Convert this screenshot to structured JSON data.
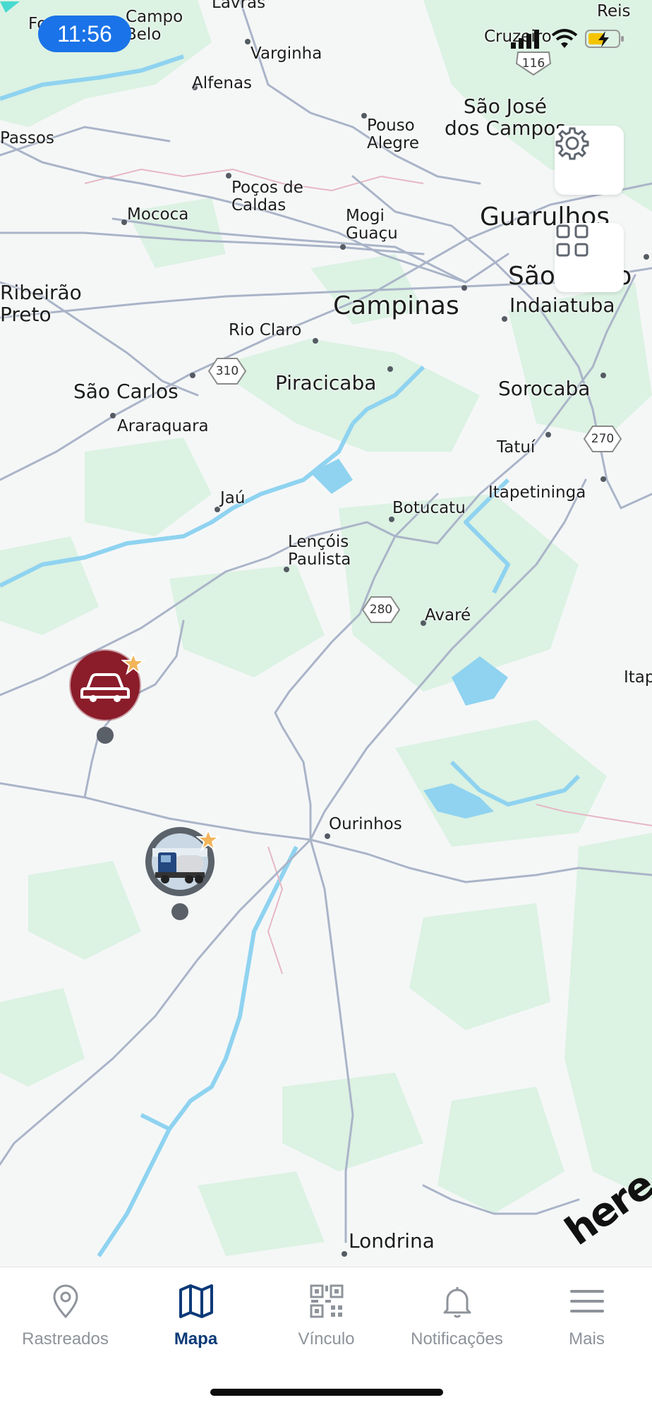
{
  "status_bar": {
    "time": "11:56"
  },
  "map": {
    "cities": [
      {
        "id": "lavras",
        "label": "Lavras"
      },
      {
        "id": "reis",
        "label": "Reis"
      },
      {
        "id": "campo-belo",
        "label": "Campo\nBelo"
      },
      {
        "id": "fo",
        "label": "Fo"
      },
      {
        "id": "cruzeiro",
        "label": "Cruzeiro"
      },
      {
        "id": "varginha",
        "label": "Varginha"
      },
      {
        "id": "alfenas",
        "label": "Alfenas"
      },
      {
        "id": "passos",
        "label": "Passos"
      },
      {
        "id": "pouso-alegre",
        "label": "Pouso\nAlegre"
      },
      {
        "id": "sao-jose",
        "label": "São José\ndos Campos"
      },
      {
        "id": "pocos",
        "label": "Poços de\nCaldas"
      },
      {
        "id": "mococa",
        "label": "Mococa"
      },
      {
        "id": "mogi",
        "label": "Mogi\nGuaçu"
      },
      {
        "id": "guarulhos",
        "label": "Guarulhos"
      },
      {
        "id": "sao-paulo",
        "label": "São Paulo"
      },
      {
        "id": "ribeirao",
        "label": "Ribeirão\nPreto"
      },
      {
        "id": "campinas",
        "label": "Campinas"
      },
      {
        "id": "indaiatuba",
        "label": "Indaiatuba"
      },
      {
        "id": "rio-claro",
        "label": "Rio Claro"
      },
      {
        "id": "sao-carlos",
        "label": "São Carlos"
      },
      {
        "id": "piracicaba",
        "label": "Piracicaba"
      },
      {
        "id": "sorocaba",
        "label": "Sorocaba"
      },
      {
        "id": "araraquara",
        "label": "Araraquara"
      },
      {
        "id": "tatui",
        "label": "Tatuí"
      },
      {
        "id": "itapetininga",
        "label": "Itapetininga"
      },
      {
        "id": "jau",
        "label": "Jaú"
      },
      {
        "id": "botucatu",
        "label": "Botucatu"
      },
      {
        "id": "lencois",
        "label": "Lençóis\nPaulista"
      },
      {
        "id": "avare",
        "label": "Avaré"
      },
      {
        "id": "itap",
        "label": "Itap"
      },
      {
        "id": "ourinhos",
        "label": "Ourinhos"
      },
      {
        "id": "londrina",
        "label": "Londrina"
      }
    ],
    "shields": [
      {
        "id": "116",
        "label": "116"
      },
      {
        "id": "310",
        "label": "310"
      },
      {
        "id": "270",
        "label": "270"
      },
      {
        "id": "280",
        "label": "280"
      }
    ],
    "markers": [
      {
        "id": "car",
        "icon": "car-icon",
        "favorite": true
      },
      {
        "id": "truck",
        "icon": "truck-photo",
        "favorite": true
      }
    ],
    "brand": "here",
    "colors": {
      "land": "#f5f7f7",
      "forest": "#dcf2e3",
      "water": "#8fd3f0",
      "road": "#aab4c8",
      "car_marker": "#8b1c2a",
      "active_tab": "#0d3a78"
    }
  },
  "controls": {
    "settings_icon": "gear-icon",
    "grid_icon": "grid-icon"
  },
  "tabbar": {
    "tabs": [
      {
        "label": "Rastreados",
        "icon": "location-pin-icon",
        "active": false
      },
      {
        "label": "Mapa",
        "icon": "map-icon",
        "active": true
      },
      {
        "label": "Vínculo",
        "icon": "qr-code-icon",
        "active": false
      },
      {
        "label": "Notificações",
        "icon": "bell-icon",
        "active": false
      },
      {
        "label": "Mais",
        "icon": "menu-icon",
        "active": false
      }
    ]
  }
}
